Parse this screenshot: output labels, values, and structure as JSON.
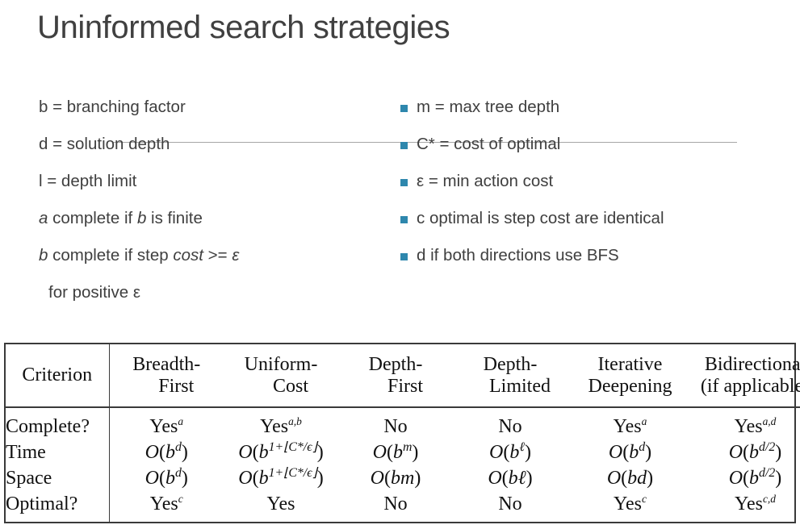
{
  "slide": {
    "title": "Uninformed search strategies"
  },
  "legend": {
    "left_items": [
      {
        "id": "branching-factor",
        "text": "b = branching factor",
        "bulleted": false,
        "indent": false
      },
      {
        "id": "solution-depth",
        "text": "d = solution depth",
        "bulleted": false,
        "indent": false
      },
      {
        "id": "depth-limit",
        "text": "l = depth limit",
        "bulleted": false,
        "indent": false
      },
      {
        "id": "note-a",
        "text": "a complete if b is finite",
        "bulleted": false,
        "indent": false
      },
      {
        "id": "note-b",
        "text": "b complete if step cost >= ε",
        "bulleted": false,
        "indent": false
      },
      {
        "id": "note-b-cont",
        "text": "for positive ε",
        "bulleted": false,
        "indent": true
      }
    ],
    "right_items": [
      {
        "id": "max-tree-depth",
        "text": "m = max tree depth",
        "bulleted": true
      },
      {
        "id": "cost-optimal",
        "text": "C* = cost of optimal",
        "bulleted": true
      },
      {
        "id": "min-action-cost",
        "text": "ε = min action cost",
        "bulleted": true
      },
      {
        "id": "note-c",
        "text": "c optimal is step cost are identical",
        "bulleted": true
      },
      {
        "id": "note-d",
        "text": "d if both directions use BFS",
        "bulleted": true
      }
    ],
    "bullet_color": "#2E87AD"
  },
  "table": {
    "corner_header": "Criterion",
    "columns": [
      {
        "id": "breadth-first",
        "line1": "Breadth-",
        "line2": "First"
      },
      {
        "id": "uniform-cost",
        "line1": "Uniform-",
        "line2": "Cost"
      },
      {
        "id": "depth-first",
        "line1": "Depth-",
        "line2": "First"
      },
      {
        "id": "depth-limited",
        "line1": "Depth-",
        "line2": "Limited"
      },
      {
        "id": "iterative-deepening",
        "line1": "Iterative",
        "line2": "Deepening"
      },
      {
        "id": "bidirectional",
        "line1": "Bidirectional",
        "line2": "(if applicable)"
      }
    ],
    "criteria": [
      "Complete?",
      "Time",
      "Space",
      "Optimal?"
    ],
    "cells": {
      "complete": [
        {
          "base": "Yes",
          "sup": "a"
        },
        {
          "base": "Yes",
          "sup": "a,b"
        },
        {
          "base": "No",
          "sup": ""
        },
        {
          "base": "No",
          "sup": ""
        },
        {
          "base": "Yes",
          "sup": "a"
        },
        {
          "base": "Yes",
          "sup": "a,d"
        }
      ],
      "time": [
        {
          "expr": "O(b^d)"
        },
        {
          "expr": "O(b^{1+⌊C*/ϵ⌋})"
        },
        {
          "expr": "O(b^m)"
        },
        {
          "expr": "O(b^ℓ)"
        },
        {
          "expr": "O(b^d)"
        },
        {
          "expr": "O(b^{d/2})"
        }
      ],
      "space": [
        {
          "expr": "O(b^d)"
        },
        {
          "expr": "O(b^{1+⌊C*/ϵ⌋})"
        },
        {
          "expr": "O(bm)"
        },
        {
          "expr": "O(bℓ)"
        },
        {
          "expr": "O(bd)"
        },
        {
          "expr": "O(b^{d/2})"
        }
      ],
      "optimal": [
        {
          "base": "Yes",
          "sup": "c"
        },
        {
          "base": "Yes",
          "sup": ""
        },
        {
          "base": "No",
          "sup": ""
        },
        {
          "base": "No",
          "sup": ""
        },
        {
          "base": "Yes",
          "sup": "c"
        },
        {
          "base": "Yes",
          "sup": "c,d"
        }
      ]
    }
  }
}
